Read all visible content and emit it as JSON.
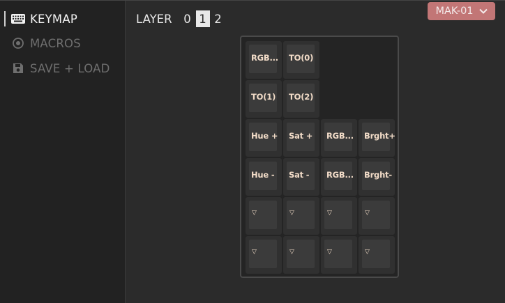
{
  "sidebar": {
    "items": [
      {
        "label": "KEYMAP",
        "icon": "keyboard-icon",
        "active": true
      },
      {
        "label": "MACROS",
        "icon": "record-icon",
        "active": false
      },
      {
        "label": "SAVE + LOAD",
        "icon": "floppy-disk-icon",
        "active": false
      }
    ]
  },
  "layers": {
    "label": "LAYER",
    "options": [
      "0",
      "1",
      "2"
    ],
    "selected": "1"
  },
  "device": {
    "name": "MAK-01",
    "icon": "chevron-down-icon",
    "color": "#c27676"
  },
  "keymap": {
    "rows": [
      [
        "RGB Mode",
        "TO(0)"
      ],
      [
        "TO(1)",
        "TO(2)"
      ],
      [
        "Hue +",
        "Sat +",
        "RGB Toggle",
        "Brght+"
      ],
      [
        "Hue -",
        "Sat -",
        "RGB Mode -",
        "Brght-"
      ],
      [
        "▽",
        "▽",
        "▽",
        "▽"
      ],
      [
        "▽",
        "▽",
        "▽",
        "▽"
      ]
    ],
    "truncated_labels": {
      "RGB Mode": "RGB...",
      "RGB Toggle": "RGB...",
      "RGB Mode -": "RGB..."
    }
  },
  "colors": {
    "background": "#2b2b2b",
    "sidebar": "#222222",
    "key_text": "#f2dcc8",
    "accent": "#c27676"
  }
}
